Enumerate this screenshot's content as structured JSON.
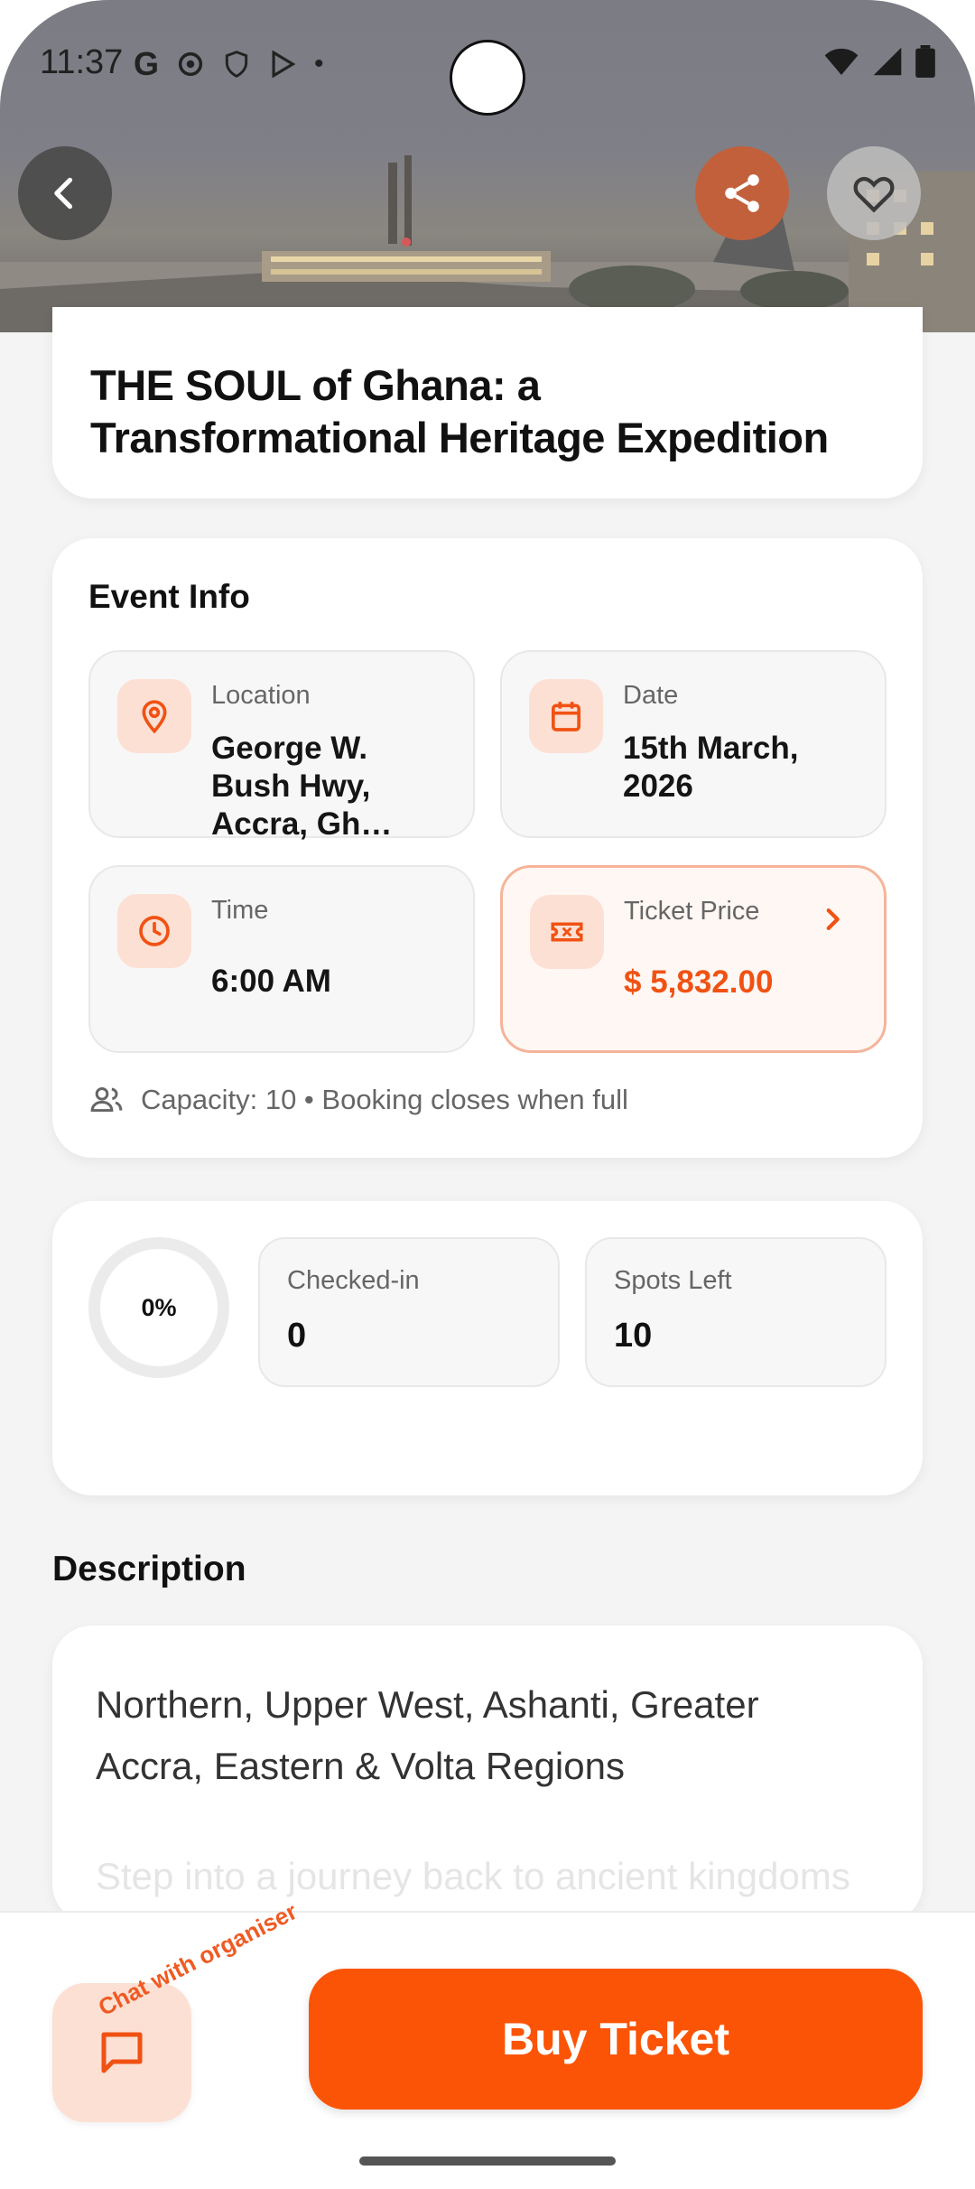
{
  "status_bar": {
    "time": "11:37"
  },
  "header": {
    "back_icon": "chevron-left-icon",
    "share_icon": "share-icon",
    "favorite_icon": "heart-outline-icon"
  },
  "event": {
    "title": "THE SOUL of Ghana: a Transformational Heritage Expedition"
  },
  "event_info": {
    "heading": "Event Info",
    "location": {
      "label": "Location",
      "value": "George W. Bush Hwy, Accra, Gh…"
    },
    "date": {
      "label": "Date",
      "value": "15th March, 2026"
    },
    "time": {
      "label": "Time",
      "value": "6:00 AM"
    },
    "ticket_price": {
      "label": "Ticket Price",
      "value": "$ 5,832.00"
    },
    "capacity_text": "Capacity: 10 • Booking closes when full"
  },
  "stats": {
    "progress_text": "0%",
    "progress": 0,
    "checked_in": {
      "label": "Checked-in",
      "value": "0"
    },
    "spots_left": {
      "label": "Spots Left",
      "value": "10"
    }
  },
  "description": {
    "heading": "Description",
    "text": "Northern, Upper West, Ashanti, Greater Accra, Eastern & Volta Regions",
    "faded_text": "Step into a journey back to ancient kingdoms"
  },
  "bottom_bar": {
    "chat_label": "Chat with organiser",
    "buy_label": "Buy Ticket"
  },
  "colors": {
    "accent": "#fb5406",
    "accent_light": "#fde0d4",
    "price": "#f05213"
  }
}
